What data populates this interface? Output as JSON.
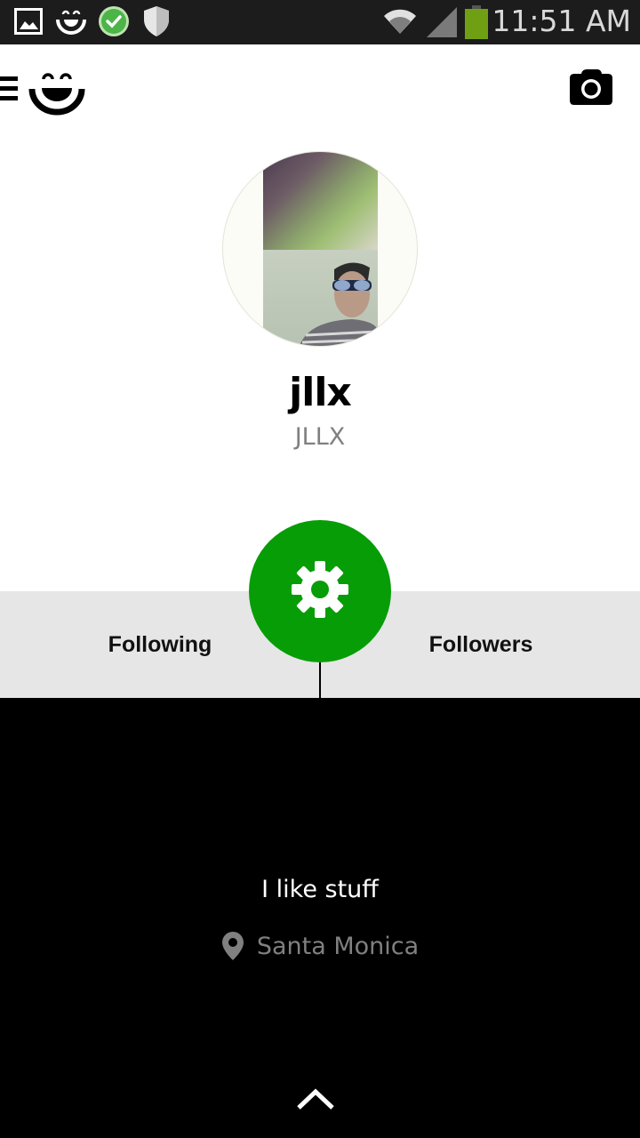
{
  "status_bar": {
    "time": "11:51 AM",
    "notification_icons": [
      "gallery-icon",
      "smiley-app-icon",
      "check-circle-icon",
      "shield-icon"
    ],
    "system_icons": [
      "wifi-icon",
      "signal-icon",
      "battery-icon"
    ],
    "battery_color": "#6fa014"
  },
  "app_bar": {
    "menu_icon": "hamburger-menu-icon",
    "logo_icon": "smiley-logo-icon",
    "camera_icon": "camera-icon"
  },
  "profile": {
    "username": "jllx",
    "display_name": "JLLX"
  },
  "tabs": {
    "following_label": "Following",
    "followers_label": "Followers"
  },
  "settings_button": {
    "icon": "gear-icon",
    "color": "#079d07"
  },
  "bio": {
    "text": "I like stuff",
    "location": "Santa Monica"
  },
  "footer": {
    "expand_icon": "chevron-up-icon"
  }
}
